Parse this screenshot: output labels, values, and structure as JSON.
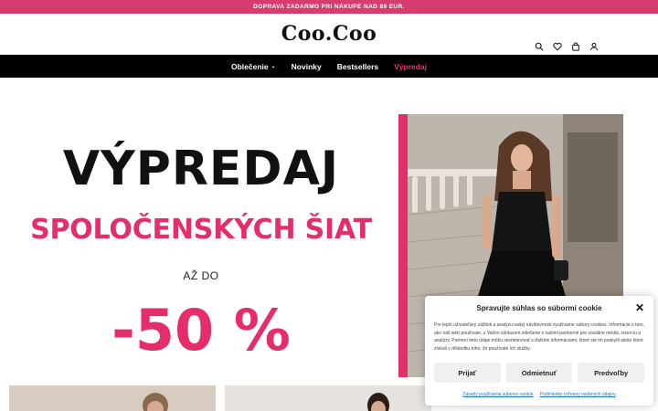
{
  "topbar": {
    "text": "DOPRAVA ZADARMO PRI NÁKUPE NAD 89 EUR."
  },
  "header": {
    "logo": "Coo.Coo",
    "icons": [
      "search-icon",
      "heart-icon",
      "bag-icon",
      "user-icon"
    ]
  },
  "nav": {
    "items": [
      {
        "label": "Oblečenie",
        "has_dropdown": true
      },
      {
        "label": "Novinky"
      },
      {
        "label": "Bestsellers"
      },
      {
        "label": "Výpredaj",
        "accent": "#e8376d"
      }
    ]
  },
  "hero": {
    "line1": "VÝPREDAJ",
    "line2": "SPOLOČENSKÝCH ŠIAT",
    "line3": "AŽ DO",
    "line4": "-50 %",
    "accent_color": "#e32e6a"
  },
  "cookie": {
    "title": "Spravujte súhlas so súbormi cookie",
    "text": "Pre lepší užívateľský zážitok a analýzu našej návštevnosti využívame súbory cookies. Informácie o tom, ako náš web používate, s Vaším súhlasom zdieľame s našimi partnermi pre sociálne médiá, inzerciu a analýzy. Partneri tieto údaje môžu skombinovať s ďalšími informáciami, ktoré ste im poskytli alebo ktoré získali v dôsledku toho, že používate ich služby.",
    "buttons": {
      "accept": "Prijať",
      "deny": "Odmietnuť",
      "preferences": "Predvoľby"
    },
    "links": {
      "cookie_policy": "Zásady používania súborov cookie",
      "privacy": "Podmienky ochrany osobných údajov"
    }
  }
}
